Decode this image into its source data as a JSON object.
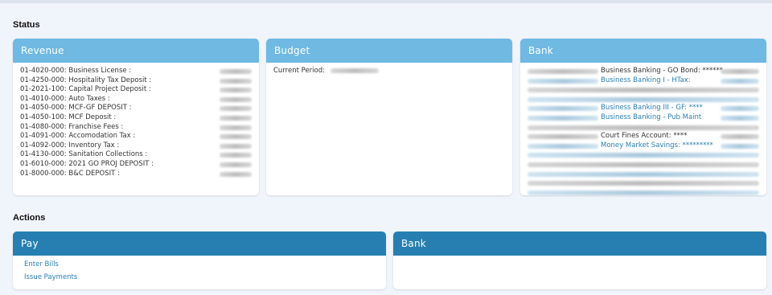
{
  "status": {
    "title": "Status",
    "revenue": {
      "title": "Revenue",
      "rows": [
        {
          "label": "01-4020-000: Business License :"
        },
        {
          "label": "01-4250-000: Hospitality Tax Deposit :"
        },
        {
          "label": "01-2021-100: Capital Project Deposit :"
        },
        {
          "label": "01-4010-000: Auto Taxes :"
        },
        {
          "label": "01-4050-000: MCF-GF DEPOSIT :"
        },
        {
          "label": "01-4050-100: MCF Deposit :"
        },
        {
          "label": "01-4080-000: Franchise Fees :"
        },
        {
          "label": "01-4091-000: Accomodation Tax :"
        },
        {
          "label": "01-4092-000: Inventory Tax :"
        },
        {
          "label": "01-4130-000: Sanitation Collections :"
        },
        {
          "label": "01-6010-000: 2021 GO PROJ DEPOSIT :"
        },
        {
          "label": "01-8000-000: B&C DEPOSIT :"
        }
      ]
    },
    "budget": {
      "title": "Budget",
      "current_period_label": "Current Period:"
    },
    "bank": {
      "title": "Bank",
      "rows": [
        {
          "text": "Business Banking - GO Bond: ******",
          "link": false
        },
        {
          "text": "Business Banking I - HTax:",
          "link": true
        },
        {
          "text": "",
          "link": false
        },
        {
          "text": "",
          "link": false
        },
        {
          "text": "Business Banking III - GF: ****",
          "link": true
        },
        {
          "text": "Business Banking - Pub Maint",
          "link": true
        },
        {
          "text": "",
          "link": false
        },
        {
          "text": "Court Fines Account: ****",
          "link": false
        },
        {
          "text": "Money Market Savings: *********",
          "link": true
        },
        {
          "text": "",
          "link": false
        },
        {
          "text": "",
          "link": false
        },
        {
          "text": "",
          "link": false
        },
        {
          "text": "",
          "link": false
        },
        {
          "text": "",
          "link": false
        }
      ]
    }
  },
  "actions": {
    "title": "Actions",
    "pay": {
      "title": "Pay",
      "links": [
        "Enter Bills",
        "Issue Payments"
      ]
    },
    "bank": {
      "title": "Bank"
    }
  }
}
